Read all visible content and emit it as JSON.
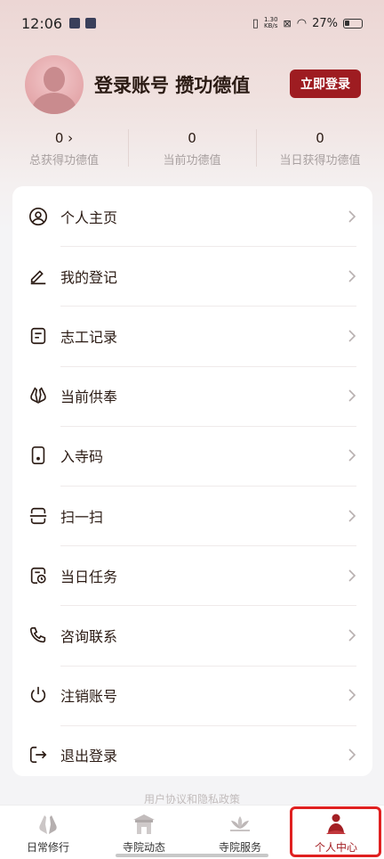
{
  "status_bar": {
    "time": "12:06",
    "net_speed_value": "1.30",
    "net_speed_unit": "KB/s",
    "battery": "27%"
  },
  "profile": {
    "title": "登录账号 攒功德值",
    "login_button": "立即登录"
  },
  "stats": [
    {
      "value": "0 ›",
      "label": "总获得功德值"
    },
    {
      "value": "0",
      "label": "当前功德值"
    },
    {
      "value": "0",
      "label": "当日获得功德值"
    }
  ],
  "menu": [
    {
      "label": "个人主页",
      "icon": "user-circle-icon"
    },
    {
      "label": "我的登记",
      "icon": "edit-icon"
    },
    {
      "label": "志工记录",
      "icon": "note-icon"
    },
    {
      "label": "当前供奉",
      "icon": "praying-hands-icon"
    },
    {
      "label": "入寺码",
      "icon": "phone-code-icon"
    },
    {
      "label": "扫一扫",
      "icon": "scan-icon"
    },
    {
      "label": "当日任务",
      "icon": "task-clock-icon"
    },
    {
      "label": "咨询联系",
      "icon": "phone-icon"
    },
    {
      "label": "注销账号",
      "icon": "power-icon"
    },
    {
      "label": "退出登录",
      "icon": "logout-icon"
    }
  ],
  "footer_link": "用户协议和隐私政策",
  "tabs": [
    {
      "label": "日常修行",
      "icon": "praying-hands-icon",
      "active": false
    },
    {
      "label": "寺院动态",
      "icon": "temple-icon",
      "active": false
    },
    {
      "label": "寺院服务",
      "icon": "lotus-icon",
      "active": false
    },
    {
      "label": "个人中心",
      "icon": "monk-icon",
      "active": true
    }
  ],
  "colors": {
    "accent": "#9e1c21",
    "highlight_border": "#e02020"
  }
}
